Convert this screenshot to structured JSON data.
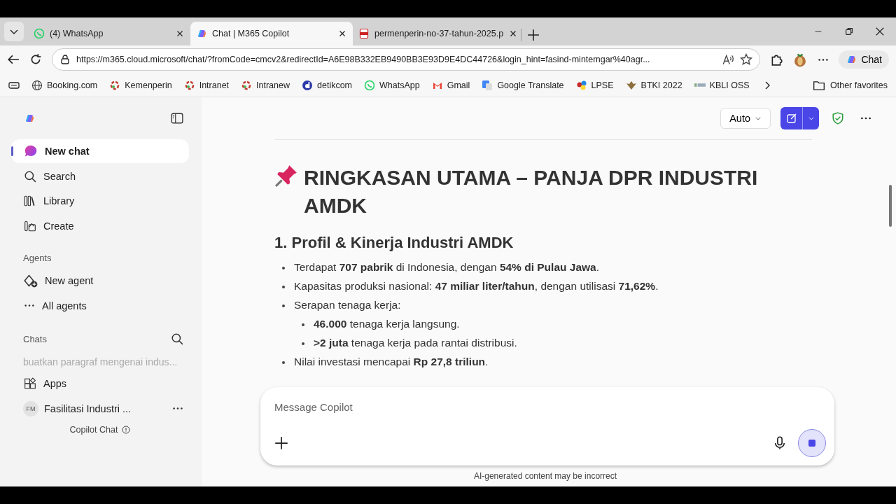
{
  "browser": {
    "tabs": [
      {
        "title": "(4) WhatsApp",
        "selected": false
      },
      {
        "title": "Chat | M365 Copilot",
        "selected": true
      },
      {
        "title": "permenperin-no-37-tahun-2025.p",
        "selected": false
      }
    ],
    "url": "https://m365.cloud.microsoft/chat/?fromCode=cmcv2&redirectId=A6E98B332EB9490BB3E93D9E4DC44726&login_hint=fasind-mintemgar%40agr...",
    "chat_button": "Chat",
    "bookmarks": [
      "Booking.com",
      "Kemenperin",
      "Intranet",
      "Intranew",
      "detikcom",
      "WhatsApp",
      "Gmail",
      "Google Translate",
      "LPSE",
      "BTKI 2022",
      "KBLI OSS"
    ],
    "other_favorites": "Other favorites"
  },
  "sidebar": {
    "items": [
      {
        "label": "New chat",
        "selected": true
      },
      {
        "label": "Search",
        "selected": false
      },
      {
        "label": "Library",
        "selected": false
      },
      {
        "label": "Create",
        "selected": false
      }
    ],
    "agents_heading": "Agents",
    "agents": [
      "New agent",
      "All agents"
    ],
    "chats_heading": "Chats",
    "recent_chat": "buatkan paragraf mengenai indus...",
    "apps": "Apps",
    "account": {
      "initials": "FM",
      "label": "Fasilitasi Industri ..."
    },
    "footer": "Copilot Chat"
  },
  "toolbar": {
    "mode": "Auto"
  },
  "content": {
    "title": "RINGKASAN UTAMA – PANJA DPR INDUSTRI AMDK",
    "heading": "1. Profil & Kinerja Industri AMDK",
    "bullets": [
      {
        "text": "Terdapat **707 pabrik** di Indonesia, dengan **54% di Pulau Jawa**."
      },
      {
        "text": "Kapasitas produksi nasional: **47 miliar liter/tahun**, dengan utilisasi **71,62%**."
      },
      {
        "text": "Serapan tenaga kerja:",
        "children": [
          {
            "text": "**46.000** tenaga kerja langsung."
          },
          {
            "text": "**>2 juta** tenaga kerja pada rantai distribusi."
          }
        ]
      },
      {
        "text": "Nilai investasi mencapai **Rp 27,8 triliun**."
      }
    ]
  },
  "composer": {
    "placeholder": "Message Copilot",
    "disclaimer": "AI-generated content may be incorrect"
  }
}
